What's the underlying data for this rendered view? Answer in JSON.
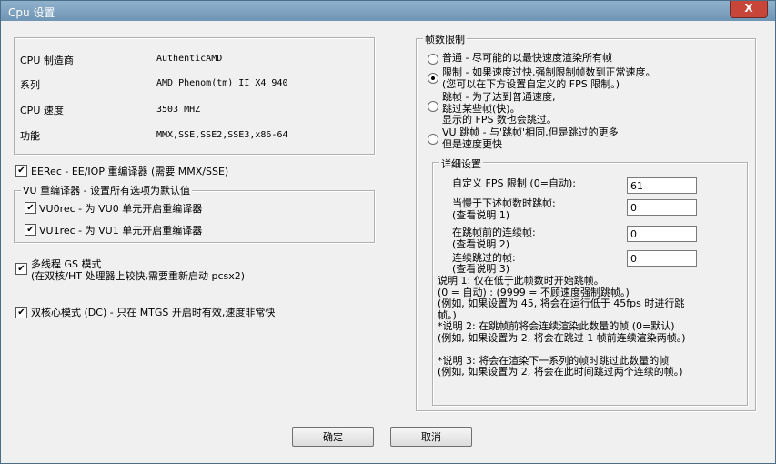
{
  "window": {
    "title": "Cpu 设置",
    "close_glyph": "X"
  },
  "cpu_info": {
    "rows": [
      {
        "label": "CPU 制造商",
        "value": "AuthenticAMD"
      },
      {
        "label": "系列",
        "value": "AMD Phenom(tm) II X4 940"
      },
      {
        "label": "CPU 速度",
        "value": "3503 MHZ"
      },
      {
        "label": "功能",
        "value": "MMX,SSE,SSE2,SSE3,x86-64"
      }
    ]
  },
  "ee_rec": {
    "label": "EERec -  EE/IOP 重编译器 (需要 MMX/SSE)",
    "checked": true
  },
  "vu_group": {
    "legend": "VU  重编译器 - 设置所有选项为默认值",
    "vu0": {
      "label": "VU0rec - 为 VU0 单元开启重编译器",
      "checked": true
    },
    "vu1": {
      "label": "VU1rec - 为 VU1 单元开启重编译器",
      "checked": true
    }
  },
  "multithread_gs": {
    "line1": "多线程 GS 模式",
    "line2": "(在双核/HT 处理器上较快,需要重新启动 pcsx2)",
    "checked": true
  },
  "dual_core": {
    "label": "双核心模式 (DC) - 只在 MTGS 开启时有效,速度非常快",
    "checked": true
  },
  "frame_limit": {
    "legend": "帧数限制",
    "options": [
      {
        "line1": "普通 - 尽可能的以最快速度渲染所有帧",
        "line2": "",
        "line3": "",
        "selected": false
      },
      {
        "line1": "限制 - 如果速度过快,强制限制帧数到正常速度。",
        "line2": "    (您可以在下方设置自定义的 FPS 限制。)",
        "line3": "",
        "selected": true
      },
      {
        "line1": "跳帧 - 为了达到普通速度,",
        "line2": "跳过某些帧(快)。",
        "line3": "显示的 FPS 数也会跳过。",
        "selected": false
      },
      {
        "line1": "VU 跳帧 - 与'跳帧'相同,但是跳过的更多",
        "line2": "但是速度更快",
        "line3": "",
        "selected": false
      }
    ]
  },
  "details": {
    "legend": "详细设置",
    "fields": [
      {
        "line1": "自定义 FPS 限制 (0=自动):",
        "line2": "",
        "value": "61"
      },
      {
        "line1": "当慢于下述帧数时跳帧:",
        "line2": "(查看说明 1)",
        "value": "0"
      },
      {
        "line1": "在跳帧前的连续帧:",
        "line2": "(查看说明 2)",
        "value": "0"
      },
      {
        "line1": "连续跳过的帧:",
        "line2": "(查看说明 3)",
        "value": "0"
      }
    ],
    "notes": [
      "说明 1: 仅在低于此帧数时开始跳帧。",
      " (0 = 自动) : (9999 = 不顾速度强制跳帧。)",
      " (例如, 如果设置为 45, 将会在运行低于 45fps 时进行跳",
      "帧。)",
      "*说明 2: 在跳帧前将会连续渲染此数量的帧 (0=默认)",
      " (例如, 如果设置为 2, 将会在跳过 1 帧前连续渲染两帧。)",
      "",
      "*说明 3: 将会在渲染下一系列的帧时跳过此数量的帧",
      " (例如, 如果设置为 2, 将会在此时间跳过两个连续的帧。)"
    ]
  },
  "buttons": {
    "ok": "确定",
    "cancel": "取消"
  }
}
